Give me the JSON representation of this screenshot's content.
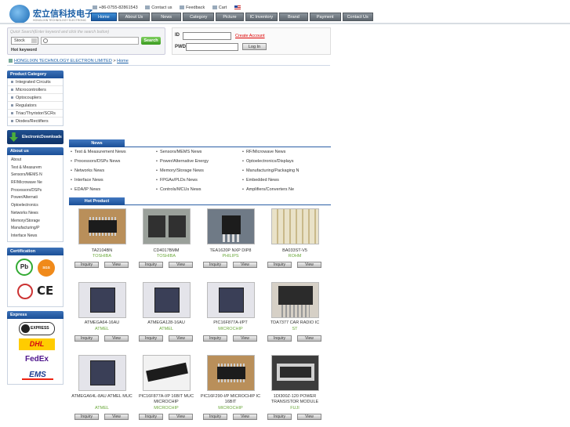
{
  "header": {
    "logo_cn": "宏立信科技电子",
    "logo_en": "HONGLIXIN TECHNOLOGY ELECTRONIC",
    "phone": "+86-0755-82861543",
    "links": [
      "Contact us",
      "Feedback",
      "Cart"
    ]
  },
  "nav": [
    "Home",
    "About Us",
    "News",
    "Category",
    "Picture",
    "IC Inventory",
    "Brand",
    "Payment",
    "Contact Us"
  ],
  "search": {
    "hint": "Quick Search(Enter keyword and click the search button)",
    "type": "Stock",
    "button": "Search",
    "hot_label": "Hot keyword"
  },
  "login": {
    "id_label": "ID",
    "create": "Create Account",
    "pwd_label": "PWD",
    "button": "Log In"
  },
  "breadcrumb": {
    "company": "HONGLIXIN TECHNOLOGY ELECTRON LIMITED",
    "sep": ">",
    "home": "Home"
  },
  "sidebar": {
    "category_title": "Product Category",
    "categories": [
      "Integrated Circuits",
      "Microcontrollers",
      "Optocouplers",
      "Regulators",
      "Triac/Thyristor/SCRs",
      "Diodes/Rectifiers"
    ],
    "download": "ElectronicDownloads",
    "about_title": "About us",
    "about_items": [
      "About",
      "Test & Measurem",
      "Sensors/MEMS N",
      "RF/Microwave Ne",
      "Processors/DSPs",
      "Power/Alternati",
      "Optoelectronics",
      "Networks News",
      "Memory/Storage",
      "Manufacturing/P",
      "Interface News"
    ],
    "cert_title": "Certification",
    "express_title": "Express",
    "express_items": [
      "EXPRESS",
      "DHL",
      "FedEx",
      "EMS"
    ],
    "cert_items": [
      "Pb",
      "SGS",
      "CE"
    ]
  },
  "news": {
    "title": "News",
    "items": [
      "Test & Measurement News",
      "Sensors/MEMS News",
      "RF/Microwave News",
      "Processors/DSPs News",
      "Power/Alternative Energy",
      "Optoelectronics/Displays",
      "Networks News",
      "Memory/Storage News",
      "Manufacturing/Packaging N",
      "Interface News",
      "FPGAs/PLDs News",
      "Embedded News",
      "EDA/IP News",
      "Controls/MCUs News",
      "Amplifiers/Converters Ne"
    ]
  },
  "hot": {
    "title": "Hot Product",
    "inquiry": "Inquiry",
    "view": "View",
    "products": [
      {
        "name": "TA2104BN",
        "brand": "TOSHIBA"
      },
      {
        "name": "CD4017BMM",
        "brand": "TOSHIBA"
      },
      {
        "name": "TEA1620P NXP DIP8",
        "brand": "PHILIPS"
      },
      {
        "name": "BA033ST-V5",
        "brand": "ROHM"
      },
      {
        "name": "ATMEGA64-16AU",
        "brand": "ATMEL"
      },
      {
        "name": "ATMEGA128-16AU",
        "brand": "ATMEL"
      },
      {
        "name": "PIC16F877A-I/PT",
        "brand": "MICROCHIP"
      },
      {
        "name": "TDA7377 CAR RADIO IC",
        "brand": "ST"
      },
      {
        "name": "ATMEGA64L-8AU ATMEL MUC",
        "brand": "ATMEL"
      },
      {
        "name": "PIC16F877A-I/P 16BIT MUC MICROCHIP",
        "brand": "MICROCHIP"
      },
      {
        "name": "PIC16F290-I/P MICROCHIP IC 16BIT",
        "brand": "MICROCHIP"
      },
      {
        "name": "1DI300Z-120 POWER TRANSISTOR MODULE",
        "brand": "FUJI"
      }
    ]
  }
}
